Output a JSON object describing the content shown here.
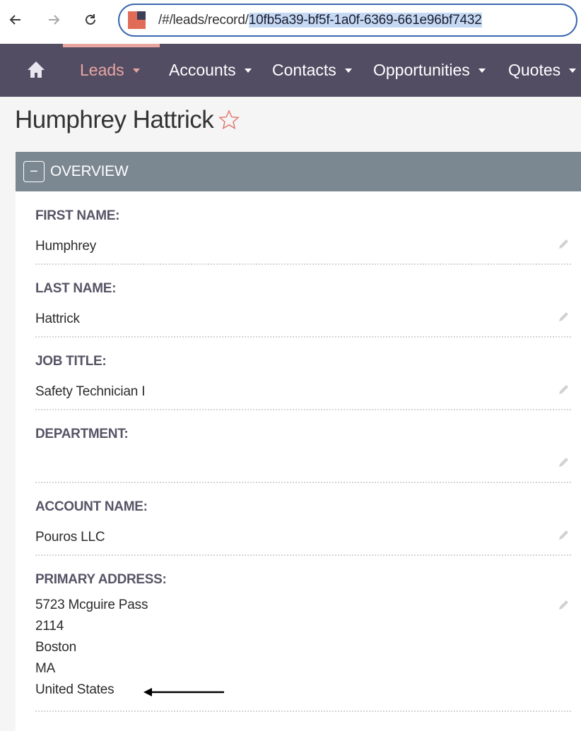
{
  "browser": {
    "url_prefix": "/#/leads/record/",
    "url_selected": "10fb5a39-bf5f-1a0f-6369-661e96bf7432",
    "back_icon": "arrow-left-icon",
    "forward_icon": "arrow-right-icon",
    "reload_icon": "reload-icon"
  },
  "nav": {
    "home_icon": "home-icon",
    "items": [
      {
        "label": "Leads",
        "active": true
      },
      {
        "label": "Accounts",
        "active": false
      },
      {
        "label": "Contacts",
        "active": false
      },
      {
        "label": "Opportunities",
        "active": false
      },
      {
        "label": "Quotes",
        "active": false
      }
    ]
  },
  "record": {
    "title": "Humphrey Hattrick",
    "favorite_icon": "star-outline-icon"
  },
  "panel": {
    "collapse_symbol": "−",
    "title": "OVERVIEW",
    "fields": [
      {
        "label": "FIRST NAME:",
        "value": [
          "Humphrey"
        ]
      },
      {
        "label": "LAST NAME:",
        "value": [
          "Hattrick"
        ]
      },
      {
        "label": "JOB TITLE:",
        "value": [
          "Safety Technician I"
        ]
      },
      {
        "label": "DEPARTMENT:",
        "value": []
      },
      {
        "label": "ACCOUNT NAME:",
        "value": [
          "Pouros LLC"
        ]
      },
      {
        "label": "PRIMARY ADDRESS:",
        "value": [
          "5723 Mcguire Pass",
          "2114",
          "Boston",
          "MA",
          "United States"
        ]
      }
    ]
  },
  "colors": {
    "nav_bg": "#534d64",
    "nav_active": "#e9a6a1",
    "panel_header": "#7b8791",
    "label": "#575466",
    "url_border": "#3a66b0",
    "url_selection": "#c5d9f5"
  }
}
